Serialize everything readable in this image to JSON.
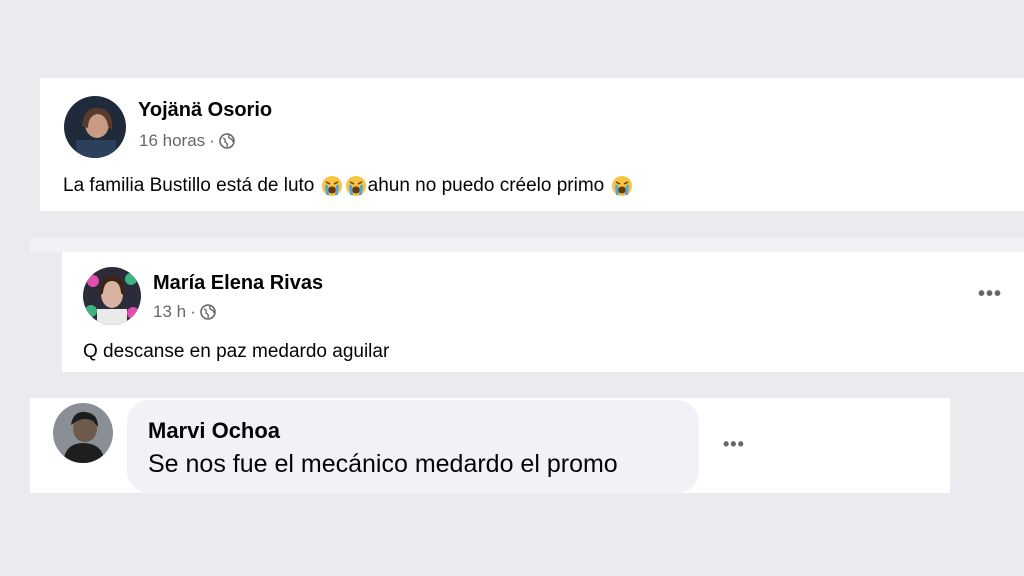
{
  "posts": [
    {
      "author": "Yojänä Osorio",
      "time": "16 horas",
      "separator": "·",
      "text_parts": [
        "La familia Bustillo está de luto ",
        "ahun no puedo créelo primo "
      ]
    },
    {
      "author": "María Elena Rivas",
      "time": "13 h",
      "separator": "·",
      "text": "Q descanse en paz medardo aguilar",
      "more_label": "•••"
    }
  ],
  "comment": {
    "author": "Marvi Ochoa",
    "text": "Se nos fue el mecánico medardo el promo",
    "more_label": "•••"
  },
  "icons": {
    "privacy": "globe-icon",
    "emoji": "loudly-crying-face-emoji"
  },
  "colors": {
    "background": "#e9ebee",
    "card": "#ffffff",
    "bubble": "#f0f2f5",
    "text": "#050505",
    "secondary": "#65676b",
    "emoji": "#f7c440"
  }
}
